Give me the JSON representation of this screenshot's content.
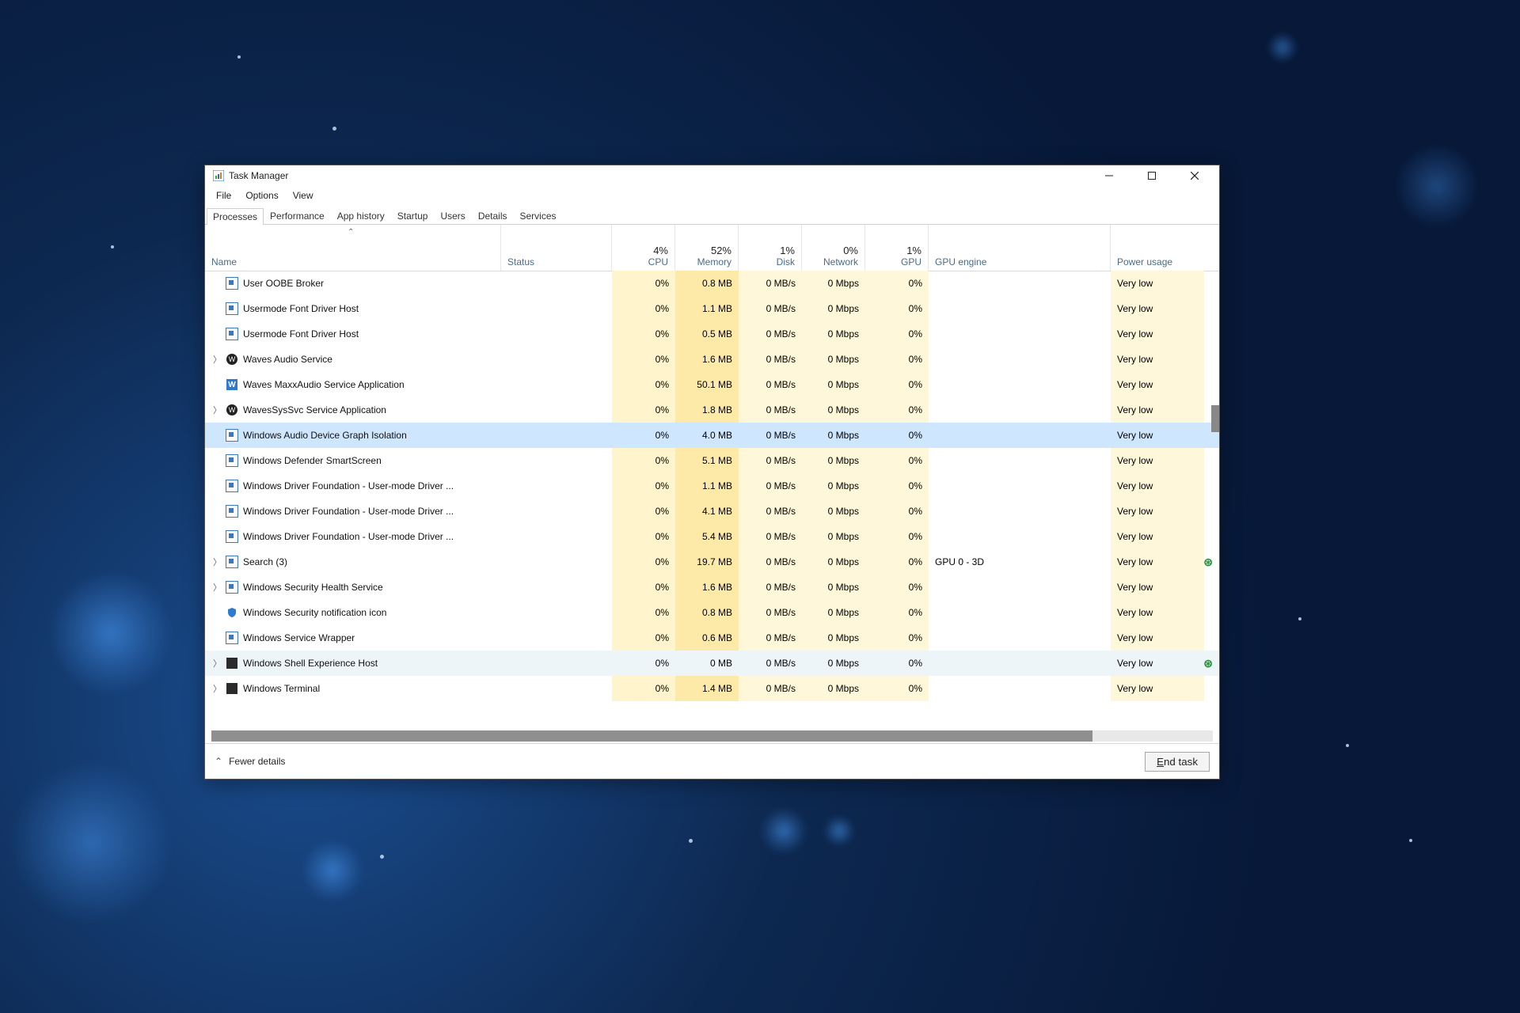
{
  "window": {
    "title": "Task Manager"
  },
  "menu": {
    "file": "File",
    "options": "Options",
    "view": "View"
  },
  "tabs": {
    "processes": "Processes",
    "performance": "Performance",
    "app_history": "App history",
    "startup": "Startup",
    "users": "Users",
    "details": "Details",
    "services": "Services"
  },
  "columns": {
    "name": "Name",
    "status": "Status",
    "cpu_pct": "4%",
    "cpu": "CPU",
    "mem_pct": "52%",
    "mem": "Memory",
    "disk_pct": "1%",
    "disk": "Disk",
    "net_pct": "0%",
    "net": "Network",
    "gpu_pct": "1%",
    "gpu": "GPU",
    "gpu_engine": "GPU engine",
    "power": "Power usage"
  },
  "footer": {
    "fewer": "Fewer details",
    "end_task_rest": "nd task"
  },
  "rows": [
    {
      "icon": "generic",
      "name": "User OOBE Broker",
      "cpu": "0%",
      "mem": "0.8 MB",
      "disk": "0 MB/s",
      "net": "0 Mbps",
      "gpu": "0%",
      "gpue": "",
      "pwr": "Very low"
    },
    {
      "icon": "generic",
      "name": "Usermode Font Driver Host",
      "cpu": "0%",
      "mem": "1.1 MB",
      "disk": "0 MB/s",
      "net": "0 Mbps",
      "gpu": "0%",
      "gpue": "",
      "pwr": "Very low"
    },
    {
      "icon": "generic",
      "name": "Usermode Font Driver Host",
      "cpu": "0%",
      "mem": "0.5 MB",
      "disk": "0 MB/s",
      "net": "0 Mbps",
      "gpu": "0%",
      "gpue": "",
      "pwr": "Very low"
    },
    {
      "icon": "waves",
      "name": "Waves Audio Service",
      "children": true,
      "cpu": "0%",
      "mem": "1.6 MB",
      "disk": "0 MB/s",
      "net": "0 Mbps",
      "gpu": "0%",
      "gpue": "",
      "pwr": "Very low"
    },
    {
      "icon": "wblue",
      "name": "Waves MaxxAudio Service Application",
      "cpu": "0%",
      "mem": "50.1 MB",
      "disk": "0 MB/s",
      "net": "0 Mbps",
      "gpu": "0%",
      "gpue": "",
      "pwr": "Very low"
    },
    {
      "icon": "waves",
      "name": "WavesSysSvc Service Application",
      "children": true,
      "cpu": "0%",
      "mem": "1.8 MB",
      "disk": "0 MB/s",
      "net": "0 Mbps",
      "gpu": "0%",
      "gpue": "",
      "pwr": "Very low"
    },
    {
      "icon": "generic",
      "name": "Windows Audio Device Graph Isolation",
      "selected": true,
      "cpu": "0%",
      "mem": "4.0 MB",
      "disk": "0 MB/s",
      "net": "0 Mbps",
      "gpu": "0%",
      "gpue": "",
      "pwr": "Very low"
    },
    {
      "icon": "generic",
      "name": "Windows Defender SmartScreen",
      "cpu": "0%",
      "mem": "5.1 MB",
      "disk": "0 MB/s",
      "net": "0 Mbps",
      "gpu": "0%",
      "gpue": "",
      "pwr": "Very low"
    },
    {
      "icon": "generic",
      "name": "Windows Driver Foundation - User-mode Driver ...",
      "cpu": "0%",
      "mem": "1.1 MB",
      "disk": "0 MB/s",
      "net": "0 Mbps",
      "gpu": "0%",
      "gpue": "",
      "pwr": "Very low"
    },
    {
      "icon": "generic",
      "name": "Windows Driver Foundation - User-mode Driver ...",
      "cpu": "0%",
      "mem": "4.1 MB",
      "disk": "0 MB/s",
      "net": "0 Mbps",
      "gpu": "0%",
      "gpue": "",
      "pwr": "Very low"
    },
    {
      "icon": "generic",
      "name": "Windows Driver Foundation - User-mode Driver ...",
      "cpu": "0%",
      "mem": "5.4 MB",
      "disk": "0 MB/s",
      "net": "0 Mbps",
      "gpu": "0%",
      "gpue": "",
      "pwr": "Very low"
    },
    {
      "icon": "generic",
      "name": "Search (3)",
      "children": true,
      "leaf": true,
      "cpu": "0%",
      "mem": "19.7 MB",
      "disk": "0 MB/s",
      "net": "0 Mbps",
      "gpu": "0%",
      "gpue": "GPU 0 - 3D",
      "pwr": "Very low"
    },
    {
      "icon": "generic",
      "name": "Windows Security Health Service",
      "children": true,
      "cpu": "0%",
      "mem": "1.6 MB",
      "disk": "0 MB/s",
      "net": "0 Mbps",
      "gpu": "0%",
      "gpue": "",
      "pwr": "Very low"
    },
    {
      "icon": "shield",
      "name": "Windows Security notification icon",
      "cpu": "0%",
      "mem": "0.8 MB",
      "disk": "0 MB/s",
      "net": "0 Mbps",
      "gpu": "0%",
      "gpue": "",
      "pwr": "Very low"
    },
    {
      "icon": "generic",
      "name": "Windows Service Wrapper",
      "cpu": "0%",
      "mem": "0.6 MB",
      "disk": "0 MB/s",
      "net": "0 Mbps",
      "gpu": "0%",
      "gpue": "",
      "pwr": "Very low"
    },
    {
      "icon": "dark",
      "name": "Windows Shell Experience Host",
      "children": true,
      "leaf": true,
      "suspended": true,
      "cpu": "0%",
      "mem": "0 MB",
      "disk": "0 MB/s",
      "net": "0 Mbps",
      "gpu": "0%",
      "gpue": "",
      "pwr": "Very low"
    },
    {
      "icon": "dark",
      "name": "Windows Terminal",
      "children": true,
      "cpu": "0%",
      "mem": "1.4 MB",
      "disk": "0 MB/s",
      "net": "0 Mbps",
      "gpu": "0%",
      "gpue": "",
      "pwr": "Very low"
    }
  ]
}
